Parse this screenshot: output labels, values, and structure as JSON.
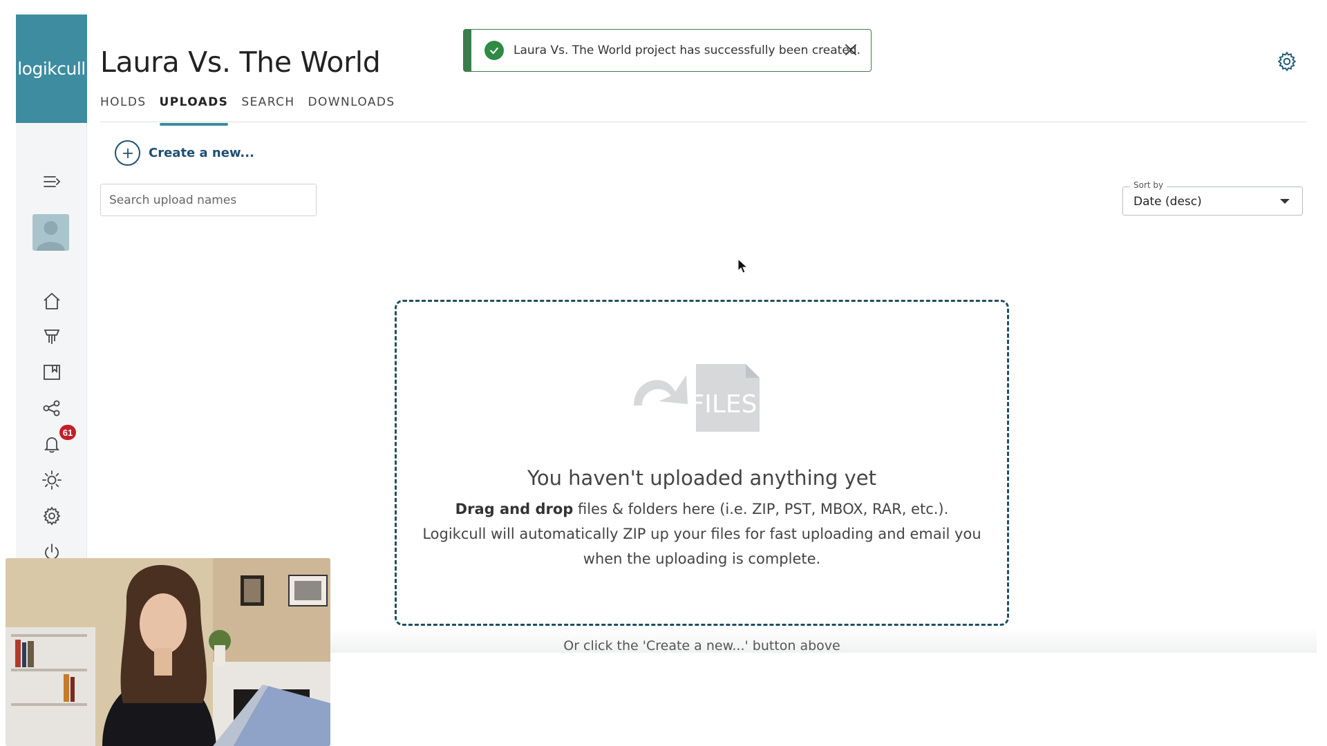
{
  "brand": {
    "logo_text": "logikcull",
    "accent": "#3d8ca0"
  },
  "header": {
    "project_title": "Laura Vs. The World",
    "tabs": [
      {
        "label": "HOLDS",
        "active": false
      },
      {
        "label": "UPLOADS",
        "active": true
      },
      {
        "label": "SEARCH",
        "active": false
      },
      {
        "label": "DOWNLOADS",
        "active": false
      }
    ]
  },
  "toast": {
    "message": "Laura Vs. The World project has successfully been created.",
    "status": "success",
    "color": "#2f8a43"
  },
  "sidebar": {
    "items": [
      {
        "name": "collapse-menu-icon"
      },
      {
        "name": "avatar"
      },
      {
        "name": "home-icon"
      },
      {
        "name": "holds-icon"
      },
      {
        "name": "library-icon"
      },
      {
        "name": "share-icon"
      },
      {
        "name": "notifications-icon"
      },
      {
        "name": "brightness-icon"
      },
      {
        "name": "settings-icon"
      },
      {
        "name": "power-icon"
      }
    ],
    "notification_count": "61"
  },
  "toolbar": {
    "create_label": "Create a new...",
    "search_placeholder": "Search upload names",
    "sort_label": "Sort by",
    "sort_value": "Date (desc)"
  },
  "dropzone": {
    "art_label": "FILES",
    "title": "You haven't uploaded anything yet",
    "line1_bold": "Drag and drop",
    "line1_rest": " files & folders here (i.e. ZIP, PST, MBOX, RAR, etc.).",
    "line2": "Logikcull will automatically ZIP up your files for fast uploading and email you",
    "line3": "when the uploading is complete.",
    "or_click": "Or click the 'Create a new...' button above"
  }
}
